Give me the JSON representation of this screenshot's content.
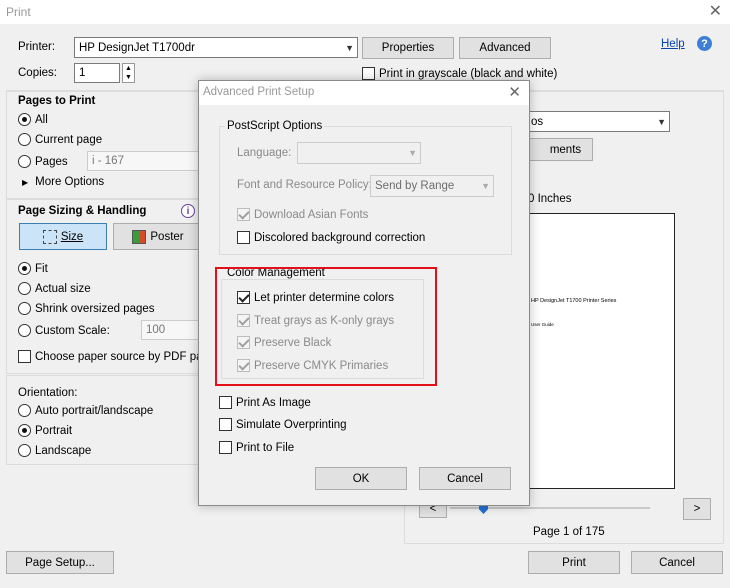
{
  "window": {
    "title": "Print"
  },
  "top": {
    "printer_label": "Printer:",
    "printer_value": "HP DesignJet T1700dr",
    "properties_label": "Properties",
    "advanced_label": "Advanced",
    "help_label": "Help",
    "copies_label": "Copies:",
    "copies_value": "1",
    "grayscale_label": "Print in grayscale (black and white)"
  },
  "pages_to_print": {
    "title": "Pages to Print",
    "all": "All",
    "current": "Current page",
    "pages": "Pages",
    "pages_value": "i - 167",
    "more_options": "More Options"
  },
  "sizing": {
    "title": "Page Sizing & Handling",
    "size_btn": "Size",
    "poster_btn": "Poster",
    "fit": "Fit",
    "actual": "Actual size",
    "shrink": "Shrink oversized pages",
    "custom": "Custom Scale:",
    "custom_value": "100",
    "choose_paper": "Choose paper source by PDF page s"
  },
  "orientation": {
    "title": "Orientation:",
    "auto": "Auto portrait/landscape",
    "portrait": "Portrait",
    "landscape": "Landscape"
  },
  "right_panel": {
    "combo_partial": "os",
    "comments_partial": "ments",
    "size_partial": "0 Inches",
    "preview_line1": "HP DesignJet T1700 Printer Series",
    "preview_line2": "User Guide",
    "page_info": "Page 1 of 175",
    "prev": "<",
    "next": ">"
  },
  "bottom": {
    "page_setup": "Page Setup...",
    "print": "Print",
    "cancel": "Cancel"
  },
  "dialog": {
    "title": "Advanced Print Setup",
    "postscript_group": "PostScript Options",
    "language_label": "Language:",
    "font_policy_label": "Font and Resource Policy:",
    "font_policy_value": "Send by Range",
    "download_asian": "Download Asian Fonts",
    "discolored_bg": "Discolored background correction",
    "color_group": "Color Management",
    "let_printer": "Let printer determine colors",
    "treat_grays": "Treat grays as K-only grays",
    "preserve_black": "Preserve Black",
    "preserve_cmyk": "Preserve CMYK Primaries",
    "print_as_image": "Print As Image",
    "simulate_overprint": "Simulate Overprinting",
    "print_to_file": "Print to File",
    "ok": "OK",
    "cancel": "Cancel"
  },
  "colors": {
    "highlight": "#e3101a",
    "accent": "#3c7fb1"
  }
}
